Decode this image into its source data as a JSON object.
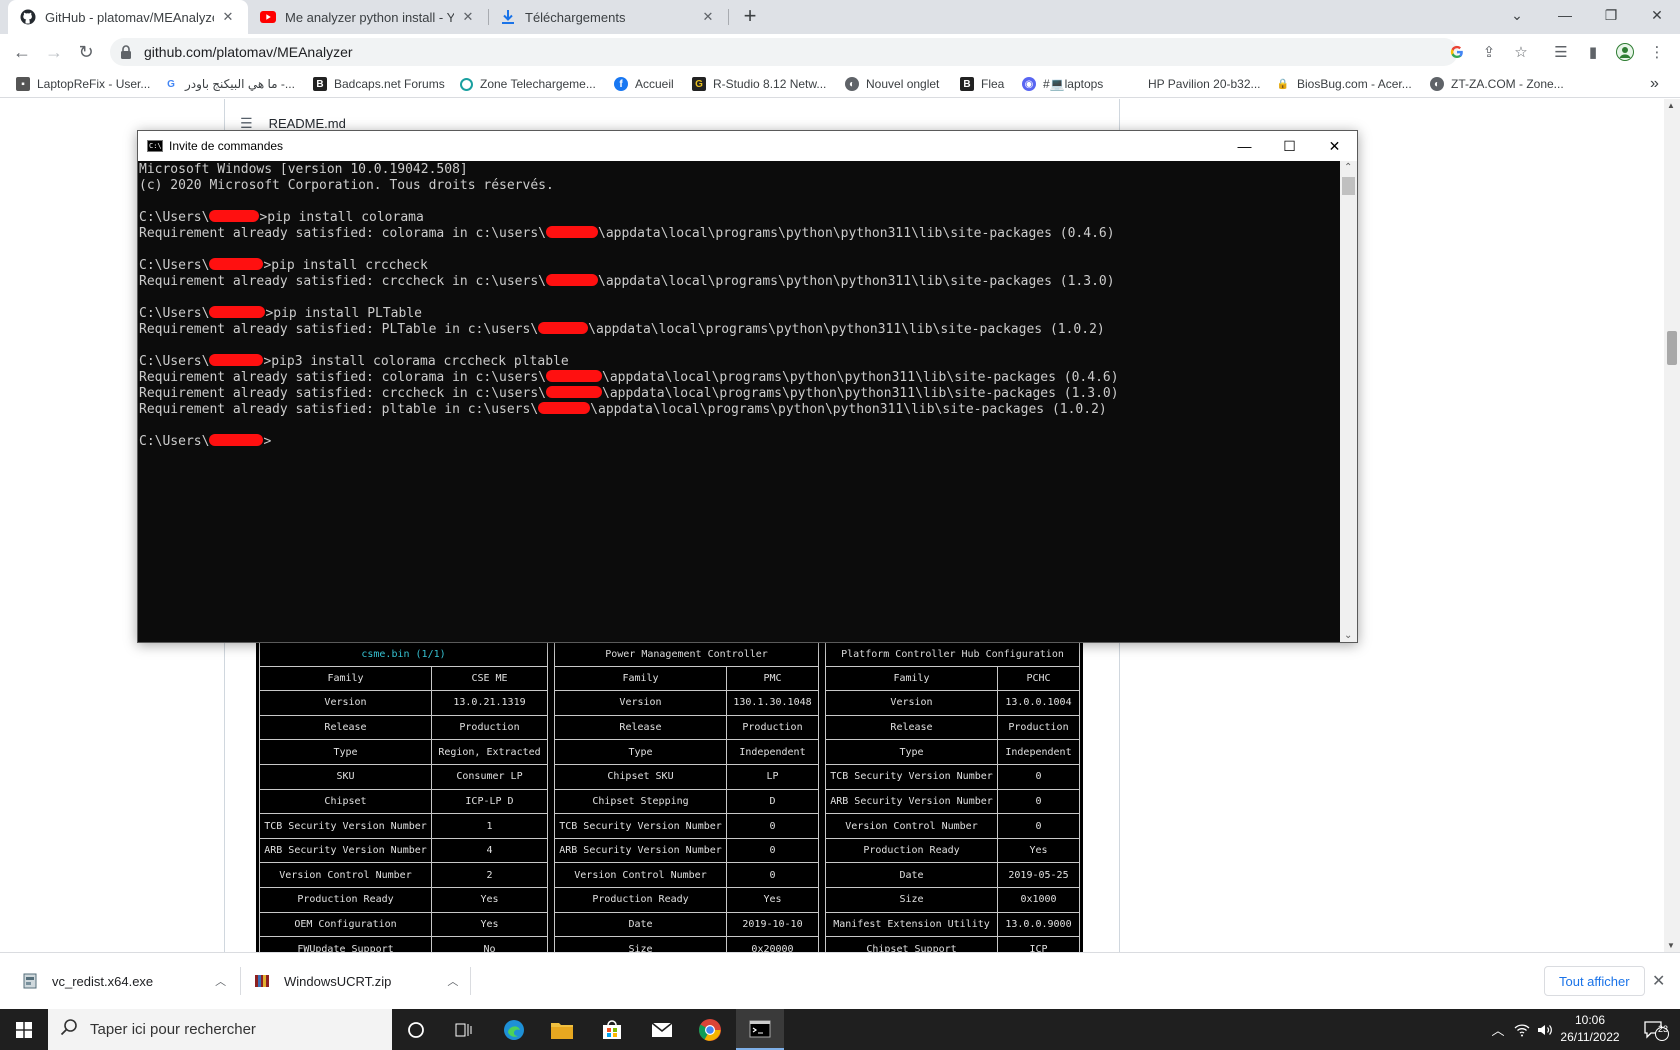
{
  "browser": {
    "tabs": [
      {
        "title": "GitHub - platomav/MEAnalyzer: I",
        "icon": "github-icon"
      },
      {
        "title": "Me analyzer python install - YouT",
        "icon": "youtube-icon"
      },
      {
        "title": "Téléchargements",
        "icon": "download-icon"
      }
    ],
    "url": "github.com/platomav/MEAnalyzer",
    "bookmarks": [
      "LaptopReFix - User...",
      "ما هي البيكنج باودر -...",
      "Badcaps.net Forums",
      "Zone Telechargeme...",
      "Accueil",
      "R-Studio 8.12 Netw...",
      "Nouvel onglet",
      "Flea",
      "#💻laptops",
      "HP Pavilion 20-b32...",
      "BiosBug.com - Acer...",
      "ZT-ZA.COM - Zone..."
    ],
    "more_bookmarks": "»"
  },
  "page": {
    "readme_label": "README.md"
  },
  "cmd": {
    "title": "Invite de commandes",
    "lines": [
      {
        "text": "Microsoft Windows [version 10.0.19042.508]"
      },
      {
        "text": "(c) 2020 Microsoft Corporation. Tous droits réservés."
      },
      {
        "text": ""
      },
      {
        "pre": "C:\\Users\\",
        "post": ">pip install colorama"
      },
      {
        "pre": "Requirement already satisfied: colorama in c:\\users\\",
        "post": "\\appdata\\local\\programs\\python\\python311\\lib\\site-packages (0.4.6)"
      },
      {
        "text": ""
      },
      {
        "pre": "C:\\Users\\",
        "post": ">pip install crccheck"
      },
      {
        "pre": "Requirement already satisfied: crccheck in c:\\users\\",
        "post": "\\appdata\\local\\programs\\python\\python311\\lib\\site-packages (1.3.0)"
      },
      {
        "text": ""
      },
      {
        "pre": "C:\\Users\\",
        "post": ">pip install PLTable"
      },
      {
        "pre": "Requirement already satisfied: PLTable in c:\\users\\",
        "post": "\\appdata\\local\\programs\\python\\python311\\lib\\site-packages (1.0.2)"
      },
      {
        "text": ""
      },
      {
        "pre": "C:\\Users\\",
        "post": ">pip3 install colorama crccheck pltable"
      },
      {
        "pre": "Requirement already satisfied: colorama in c:\\users\\",
        "post": "\\appdata\\local\\programs\\python\\python311\\lib\\site-packages (0.4.6)"
      },
      {
        "pre": "Requirement already satisfied: crccheck in c:\\users\\",
        "post": "\\appdata\\local\\programs\\python\\python311\\lib\\site-packages (1.3.0)"
      },
      {
        "pre": "Requirement already satisfied: pltable in c:\\users\\",
        "post": "\\appdata\\local\\programs\\python\\python311\\lib\\site-packages (1.0.2)"
      },
      {
        "text": ""
      },
      {
        "pre": "C:\\Users\\",
        "post": ">"
      }
    ]
  },
  "me_tables": [
    {
      "title": "csme.bin (1/1)",
      "rows": [
        [
          "Family",
          "CSE ME"
        ],
        [
          "Version",
          "13.0.21.1319"
        ],
        [
          "Release",
          "Production"
        ],
        [
          "Type",
          "Region, Extracted"
        ],
        [
          "SKU",
          "Consumer LP"
        ],
        [
          "Chipset",
          "ICP-LP D"
        ],
        [
          "TCB Security Version Number",
          "1"
        ],
        [
          "ARB Security Version Number",
          "4"
        ],
        [
          "Version Control Number",
          "2"
        ],
        [
          "Production Ready",
          "Yes"
        ],
        [
          "OEM Configuration",
          "Yes"
        ],
        [
          "FWUpdate Support",
          "No"
        ]
      ]
    },
    {
      "title": "Power Management Controller",
      "rows": [
        [
          "Family",
          "PMC"
        ],
        [
          "Version",
          "130.1.30.1048"
        ],
        [
          "Release",
          "Production"
        ],
        [
          "Type",
          "Independent"
        ],
        [
          "Chipset SKU",
          "LP"
        ],
        [
          "Chipset Stepping",
          "D"
        ],
        [
          "TCB Security Version Number",
          "0"
        ],
        [
          "ARB Security Version Number",
          "0"
        ],
        [
          "Version Control Number",
          "0"
        ],
        [
          "Production Ready",
          "Yes"
        ],
        [
          "Date",
          "2019-10-10"
        ],
        [
          "Size",
          "0x20000"
        ]
      ]
    },
    {
      "title": "Platform Controller Hub Configuration",
      "rows": [
        [
          "Family",
          "PCHC"
        ],
        [
          "Version",
          "13.0.0.1004"
        ],
        [
          "Release",
          "Production"
        ],
        [
          "Type",
          "Independent"
        ],
        [
          "TCB Security Version Number",
          "0"
        ],
        [
          "ARB Security Version Number",
          "0"
        ],
        [
          "Version Control Number",
          "0"
        ],
        [
          "Production Ready",
          "Yes"
        ],
        [
          "Date",
          "2019-05-25"
        ],
        [
          "Size",
          "0x1000"
        ],
        [
          "Manifest Extension Utility",
          "13.0.0.9000"
        ],
        [
          "Chipset Support",
          "ICP"
        ]
      ]
    }
  ],
  "downloads": {
    "items": [
      "vc_redist.x64.exe",
      "WindowsUCRT.zip"
    ],
    "show_all": "Tout afficher"
  },
  "taskbar": {
    "search_placeholder": "Taper ici pour rechercher",
    "time": "10:06",
    "date": "26/11/2022",
    "notification_count": "23"
  },
  "colors": {
    "redaction": "#ff1010",
    "cmd_background": "#0c0c0c",
    "cmd_text": "#cccccc",
    "table_title_cyan": "#38c7d8",
    "link_blue": "#1a73e8"
  }
}
